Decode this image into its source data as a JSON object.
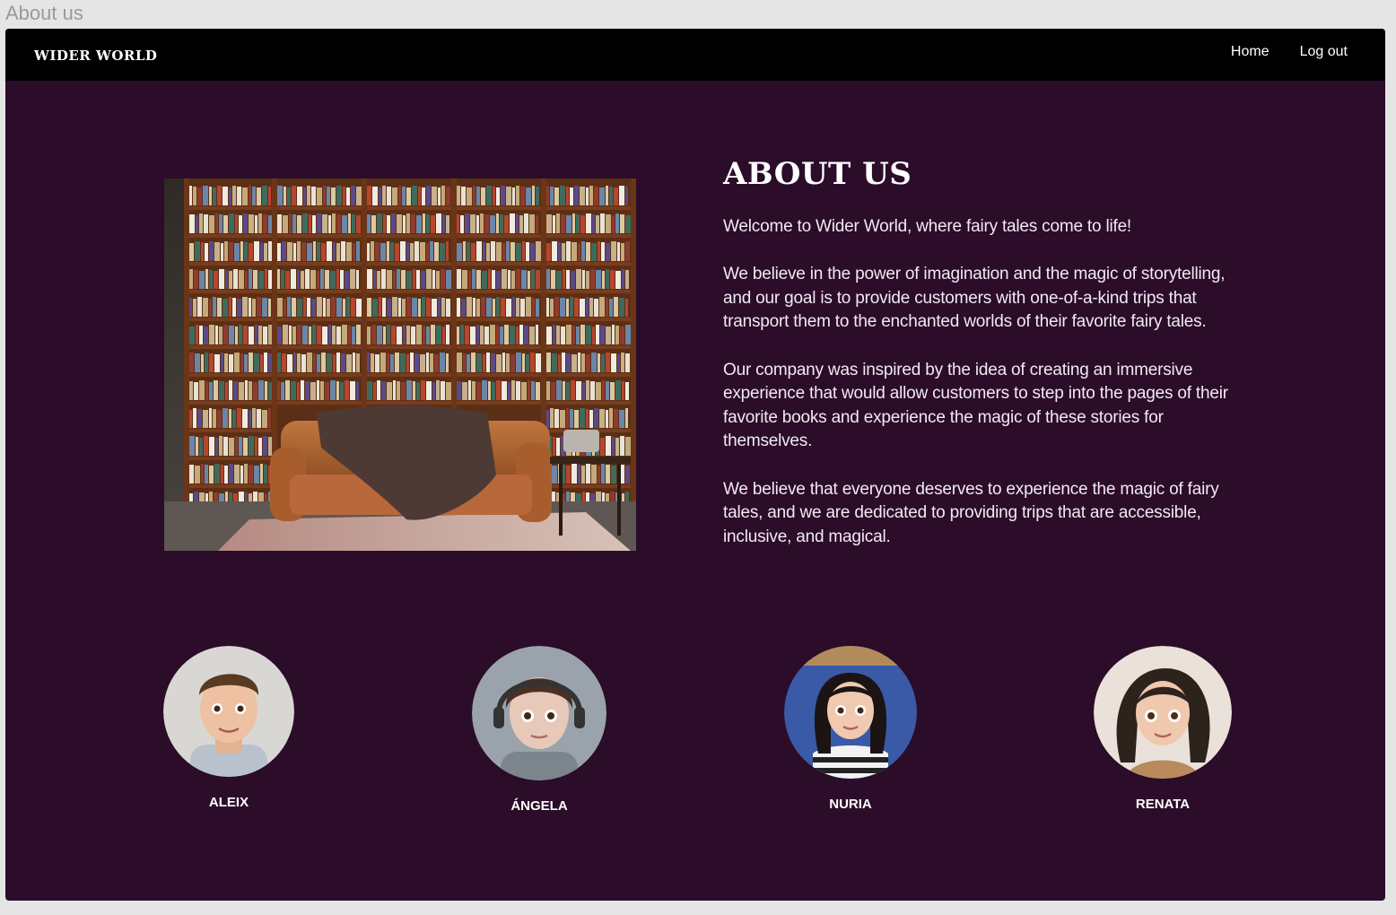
{
  "window_label": "About us",
  "nav": {
    "brand": "WIDER WORLD",
    "links": [
      {
        "label": "Home"
      },
      {
        "label": "Log out"
      }
    ]
  },
  "about": {
    "title": "ABOUT US",
    "paragraphs": [
      "Welcome to Wider World, where fairy tales come to life!",
      "We believe in the power of imagination and the magic of storytelling, and our goal is to provide customers with one-of-a-kind trips that transport them to the enchanted worlds of their favorite fairy tales.",
      "Our company was inspired by the idea of creating an immersive experience that would allow customers to step into the pages of their favorite books and experience the magic of these stories for themselves.",
      "We believe that everyone deserves to experience the magic of fairy tales, and we are dedicated to providing trips that are accessible, inclusive, and magical."
    ]
  },
  "team": [
    {
      "name": "ALEIX"
    },
    {
      "name": "ÁNGELA"
    },
    {
      "name": "NURIA"
    },
    {
      "name": "RENATA"
    }
  ],
  "colors": {
    "background": "#2b0c29",
    "navbar": "#000000",
    "text": "#ffffff"
  }
}
